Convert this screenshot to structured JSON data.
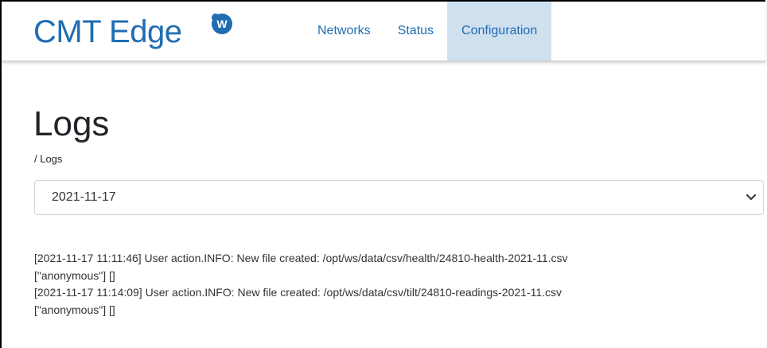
{
  "brand": {
    "name": "CMT Edge",
    "badge_letter": "W",
    "color": "#1f6db3"
  },
  "nav": {
    "items": [
      {
        "label": "Networks",
        "active": false
      },
      {
        "label": "Status",
        "active": false
      },
      {
        "label": "Configuration",
        "active": true
      }
    ],
    "active_bg": "#cfe0ef"
  },
  "page": {
    "title": "Logs",
    "breadcrumb": "/ Logs"
  },
  "date_select": {
    "selected": "2021-11-17",
    "icon": "chevron-down-icon"
  },
  "logs": [
    "[2021-11-17 11:11:46] User action.INFO: New file created: /opt/ws/data/csv/health/24810-health-2021-11.csv",
    "[\"anonymous\"] []",
    "[2021-11-17 11:14:09] User action.INFO: New file created: /opt/ws/data/csv/tilt/24810-readings-2021-11.csv",
    "[\"anonymous\"] []"
  ]
}
